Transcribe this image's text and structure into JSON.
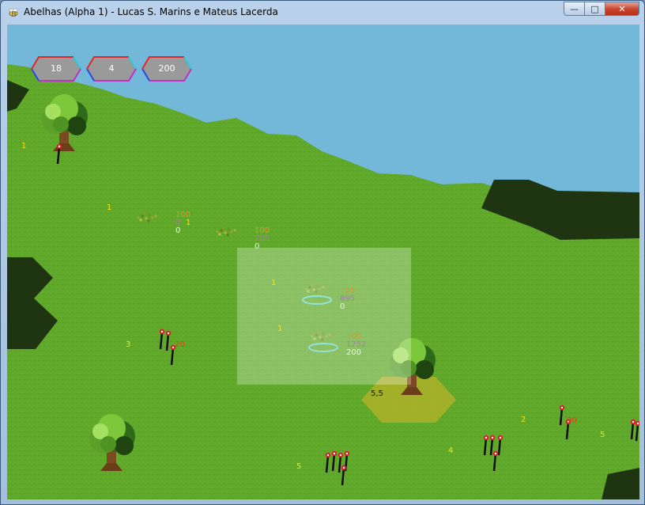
{
  "window": {
    "title": "Abelhas (Alpha 1) - Lucas S. Marins e Mateus Lacerda",
    "controls": [
      "minimize",
      "maximize",
      "close"
    ]
  },
  "hud": [
    {
      "name": "hud-counter-1",
      "value": "18"
    },
    {
      "name": "hud-counter-2",
      "value": "4"
    },
    {
      "name": "hud-counter-3",
      "value": "200"
    }
  ],
  "colors": {
    "water": "#73b8d8",
    "grass": "#5fa82a",
    "shadow": "#1f3512",
    "selection": "#ffffff",
    "highlight_tile": "#b8b32a",
    "label_yellow": "#f2e21a",
    "label_orange": "#ff8a1a",
    "label_purple": "#c06ad0"
  },
  "tile_labels": {
    "t1": "1",
    "t2": "1",
    "t3": "1",
    "t4": "1",
    "t5": "3",
    "t6": "5",
    "t7": "4",
    "t8": "2",
    "t9": "5"
  },
  "swarms": [
    {
      "health": "100",
      "food": "0",
      "count": "0",
      "extra": "1"
    },
    {
      "health": "100",
      "food": "705",
      "count": "0"
    },
    {
      "health": "100",
      "food": "895",
      "count": "0"
    },
    {
      "health": "100",
      "food": "1752",
      "count": "200"
    }
  ],
  "flower_labels": {
    "f1": "20",
    "f2": "90"
  },
  "selected_tile": {
    "coord": "5,5"
  },
  "icons": {
    "app": "bee-icon",
    "tree": "tree-icon",
    "flower": "flower-icon",
    "swarm": "bee-swarm-icon",
    "hive": "hive-icon"
  }
}
